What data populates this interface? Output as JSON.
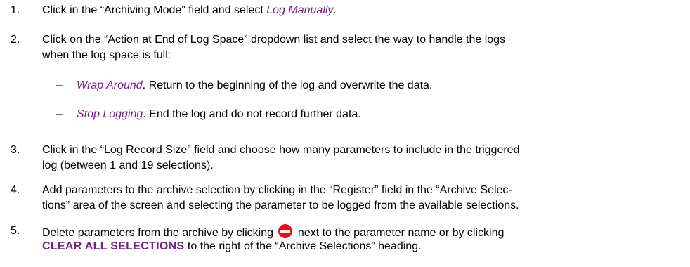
{
  "steps": [
    {
      "number": "1.",
      "pre": "Click in the “Archiving Mode” field and select ",
      "emph": "Log Manually",
      "post": "."
    },
    {
      "number": "2.",
      "line1": "Click on the “Action at End of Log Space” dropdown list and select the way to handle the logs",
      "line2": "when the log space is full:",
      "options": [
        {
          "dash": "–",
          "emph": "Wrap Around",
          "text": ". Return to the beginning of the log and overwrite the data."
        },
        {
          "dash": "–",
          "emph": "Stop Logging",
          "text": ". End the log and do not record further data."
        }
      ]
    },
    {
      "number": "3.",
      "line1": "Click in the “Log Record Size” field and choose how many parameters to include in the triggered",
      "line2": "log (between 1 and 19 selections)."
    },
    {
      "number": "4.",
      "line1": "Add parameters to the archive selection by clicking in the “Register” field in the “Archive Selec-",
      "line2": "tions” area of the screen and selecting the parameter to be logged from the available selections."
    },
    {
      "number": "5.",
      "line1_pre": "Delete parameters from the archive by clicking ",
      "line1_post": " next to the parameter name or by clicking",
      "link": "CLEAR ALL SELECTIONS",
      "line2_post": " to the right of the “Archive Selections” heading.",
      "icon": "delete-icon",
      "icon_color": "#e8101a"
    }
  ]
}
